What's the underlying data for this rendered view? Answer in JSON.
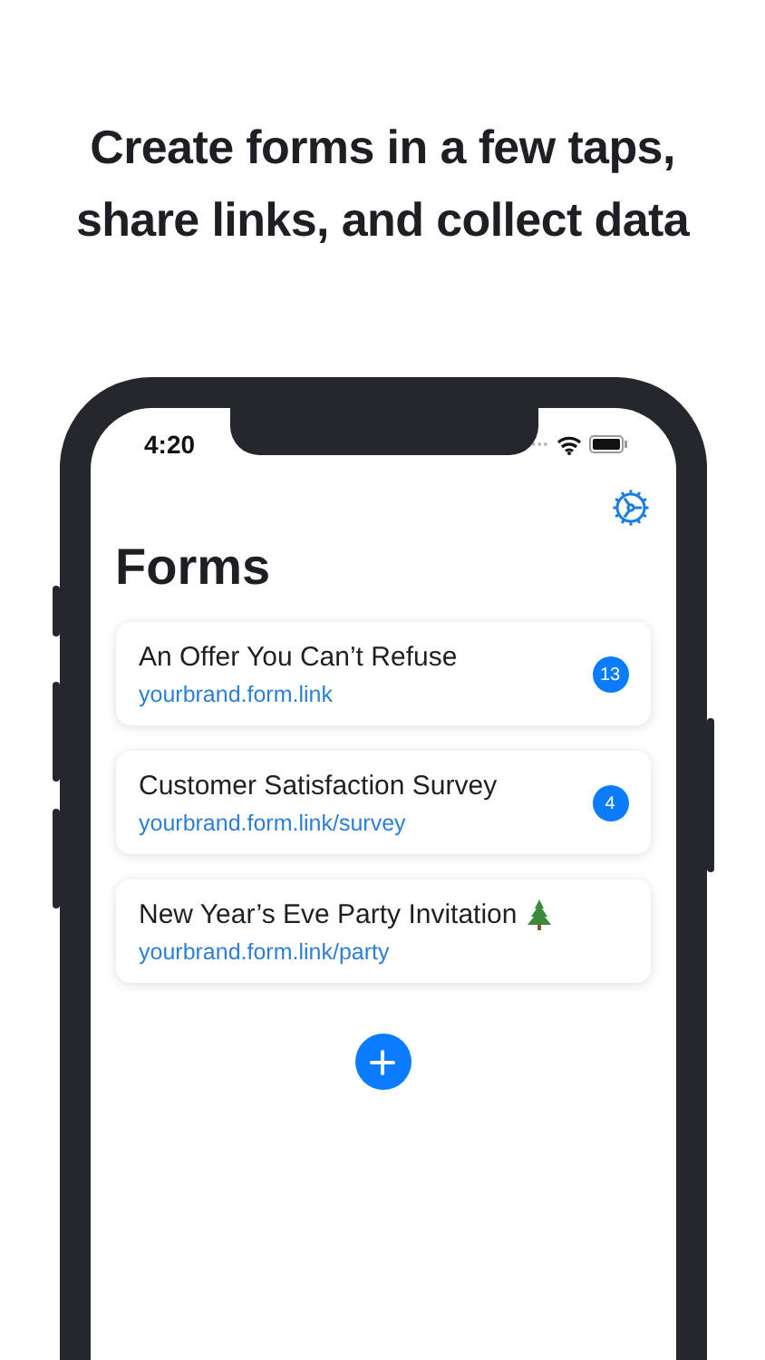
{
  "headline": [
    "Create forms in a few taps,",
    "share links, and collect data"
  ],
  "status_bar": {
    "time": "4:20"
  },
  "screen": {
    "title": "Forms"
  },
  "forms": [
    {
      "title": "An Offer You Can’t Refuse",
      "link": "yourbrand.form.link",
      "count": "13",
      "has_tree": false
    },
    {
      "title": "Customer Satisfaction Survey",
      "link": "yourbrand.form.link/survey",
      "count": "4",
      "has_tree": false
    },
    {
      "title": "New Year’s Eve Party Invitation",
      "link": "yourbrand.form.link/party",
      "has_tree": true
    }
  ]
}
